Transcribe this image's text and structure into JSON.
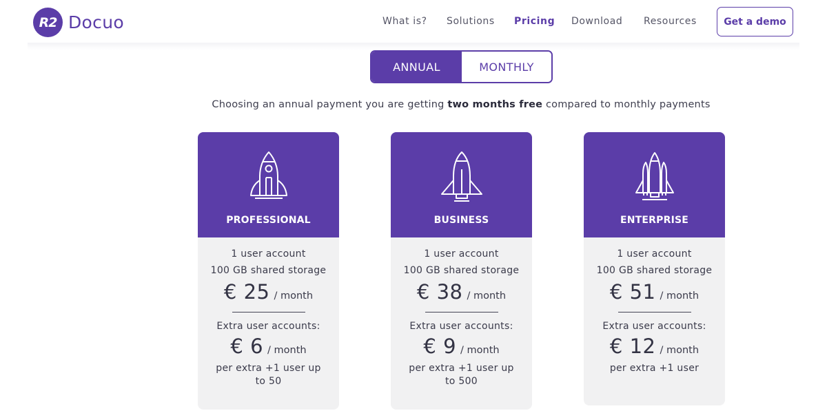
{
  "brand": {
    "badge": "R2",
    "name": "Docuo"
  },
  "nav": {
    "items": [
      {
        "label": "What is?"
      },
      {
        "label": "Solutions"
      },
      {
        "label": "Pricing",
        "active": true
      },
      {
        "label": "Download"
      },
      {
        "label": "Resources"
      }
    ],
    "demo_label": "Get a demo"
  },
  "billing_toggle": {
    "annual": "ANNUAL",
    "monthly": "MONTHLY",
    "selected": "ANNUAL"
  },
  "subtitle": {
    "pre": "Choosing an annual payment you are getting ",
    "bold": "two months free",
    "post": " compared to monthly payments"
  },
  "plans": [
    {
      "name": "PROFESSIONAL",
      "icon": "rocket-icon",
      "users": "1 user account",
      "storage": "100 GB shared storage",
      "price": "€ 25",
      "per": "/ month",
      "extra_label": "Extra user accounts:",
      "extra_price": "€ 6",
      "extra_per": "/ month",
      "extra_note": "per extra +1 user up to 50"
    },
    {
      "name": "BUSINESS",
      "icon": "shuttle-icon",
      "users": "1 user account",
      "storage": "100 GB shared storage",
      "price": "€ 38",
      "per": "/ month",
      "extra_label": "Extra user accounts:",
      "extra_price": "€ 9",
      "extra_per": "/ month",
      "extra_note": "per extra +1 user up to 500"
    },
    {
      "name": "ENTERPRISE",
      "icon": "space-shuttle-boosters-icon",
      "users": "1 user account",
      "storage": "100 GB shared storage",
      "price": "€ 51",
      "per": "/ month",
      "extra_label": "Extra user accounts:",
      "extra_price": "€ 12",
      "extra_per": "/ month",
      "extra_note": "per extra +1 user"
    }
  ],
  "colors": {
    "brand": "#5b3da8",
    "card_bg": "#f1f1f2"
  }
}
